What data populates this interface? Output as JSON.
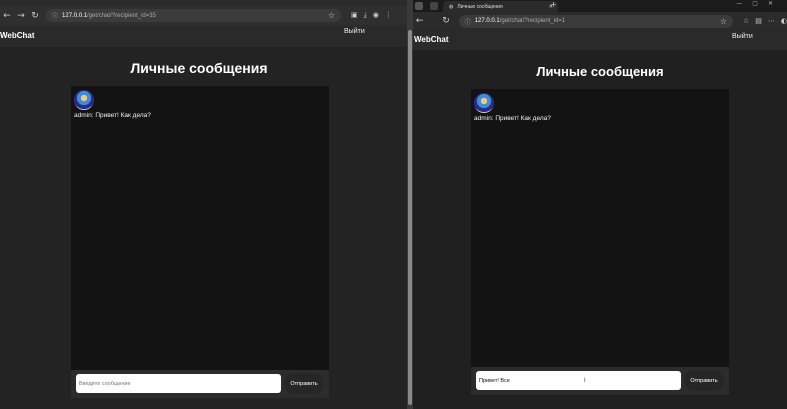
{
  "left": {
    "url_host": "127.0.0.1",
    "url_path": "/get/chat/?recipient_id=35",
    "brand": "WebChat",
    "logout": "Выйти",
    "title": "Личные сообщения",
    "message": "admin: Привет! Как дела?",
    "input_placeholder": "Введите сообщение",
    "input_value": "",
    "send_label": "Отправить"
  },
  "right": {
    "tab_title": "Личные сообщения",
    "url_host": "127.0.0.1",
    "url_path": "/get/chat/?recipient_id=1",
    "brand": "WebChat",
    "logout": "Выйти",
    "title": "Личные сообщения",
    "message": "admin: Привет! Как дела?",
    "input_placeholder": "",
    "input_value": "Привет! Все",
    "send_label": "Отправить"
  },
  "icons": {
    "back": "←",
    "forward": "→",
    "reload": "↻",
    "info": "ⓘ",
    "star": "☆",
    "close": "✕",
    "new_tab": "+"
  }
}
